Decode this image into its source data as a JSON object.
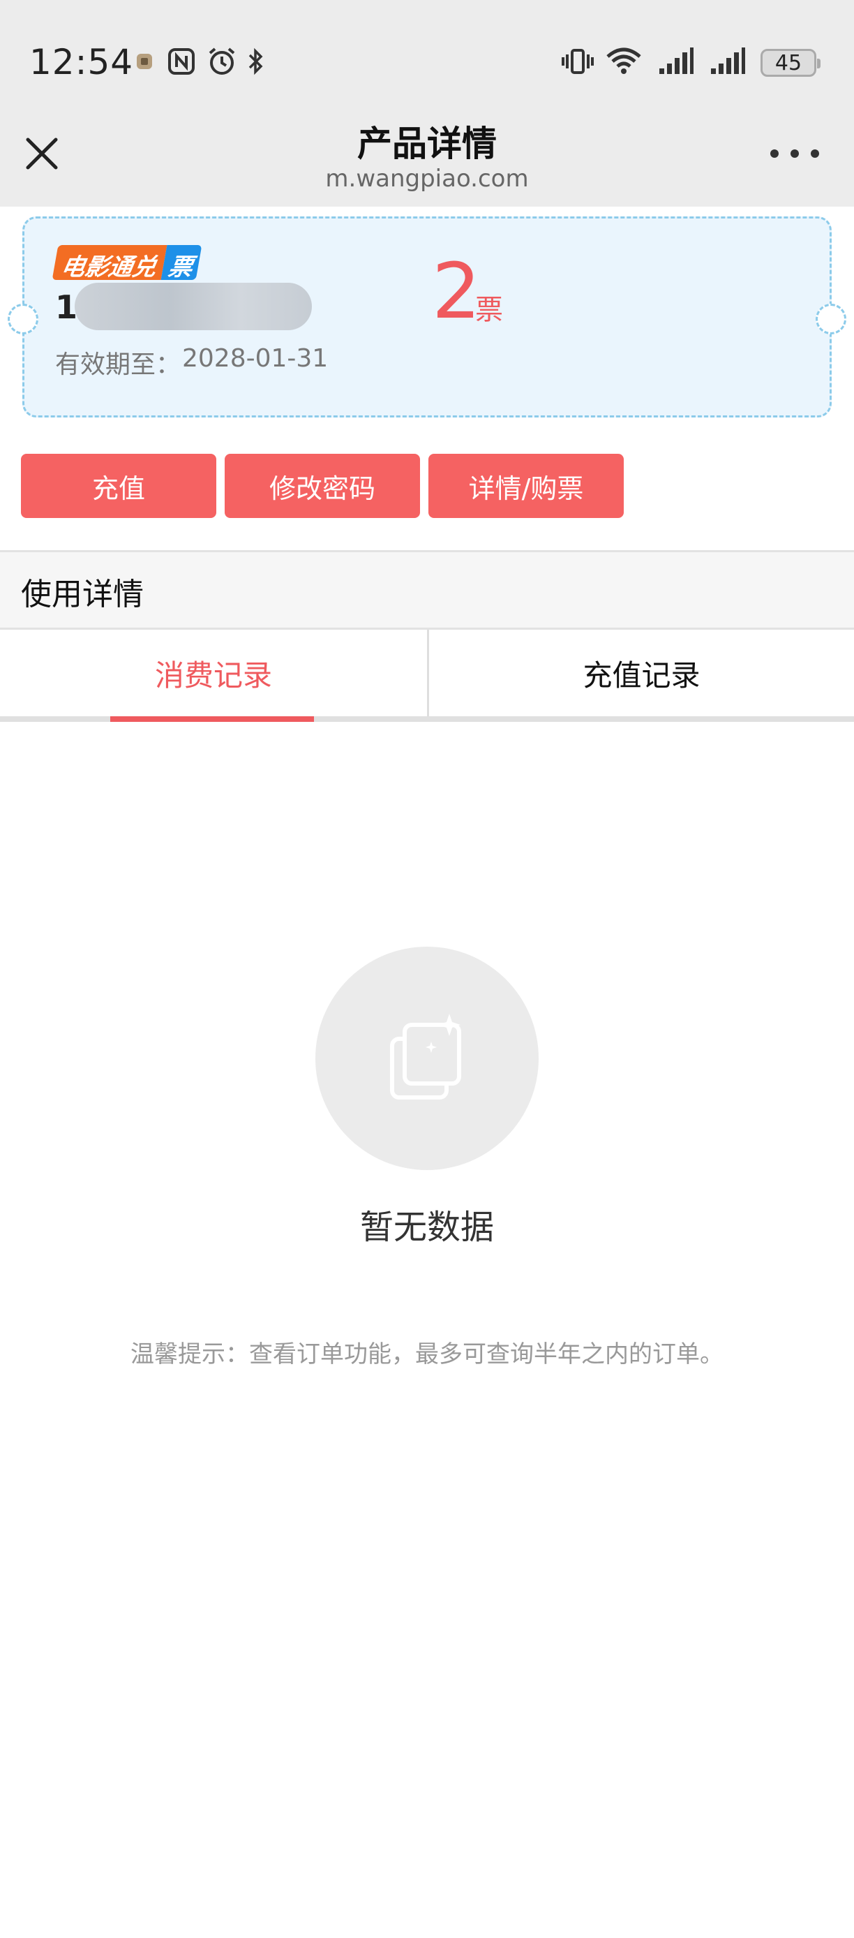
{
  "status_bar": {
    "time": "12:54",
    "battery": "45"
  },
  "nav": {
    "title": "产品详情",
    "url": "m.wangpiao.com"
  },
  "ticket": {
    "badge_main": "电影通兑",
    "badge_suffix": "票",
    "card_number_visible": "1",
    "count": "2",
    "count_unit": "票",
    "expiry_label": "有效期至：",
    "expiry_date": "2028-01-31"
  },
  "actions": {
    "recharge": "充值",
    "change_password": "修改密码",
    "detail_buy": "详情/购票"
  },
  "usage": {
    "title": "使用详情",
    "tabs": [
      {
        "label": "消费记录",
        "active": true
      },
      {
        "label": "充值记录",
        "active": false
      }
    ]
  },
  "empty_state": {
    "message": "暂无数据",
    "tip": "温馨提示：查看订单功能，最多可查询半年之内的订单。"
  },
  "colors": {
    "accent": "#ef5a5e",
    "button": "#f56262",
    "ticket_bg": "#eaf5fd",
    "ticket_border": "#8ccbea",
    "badge_orange": "#f36d23",
    "badge_blue": "#1e90e8"
  }
}
